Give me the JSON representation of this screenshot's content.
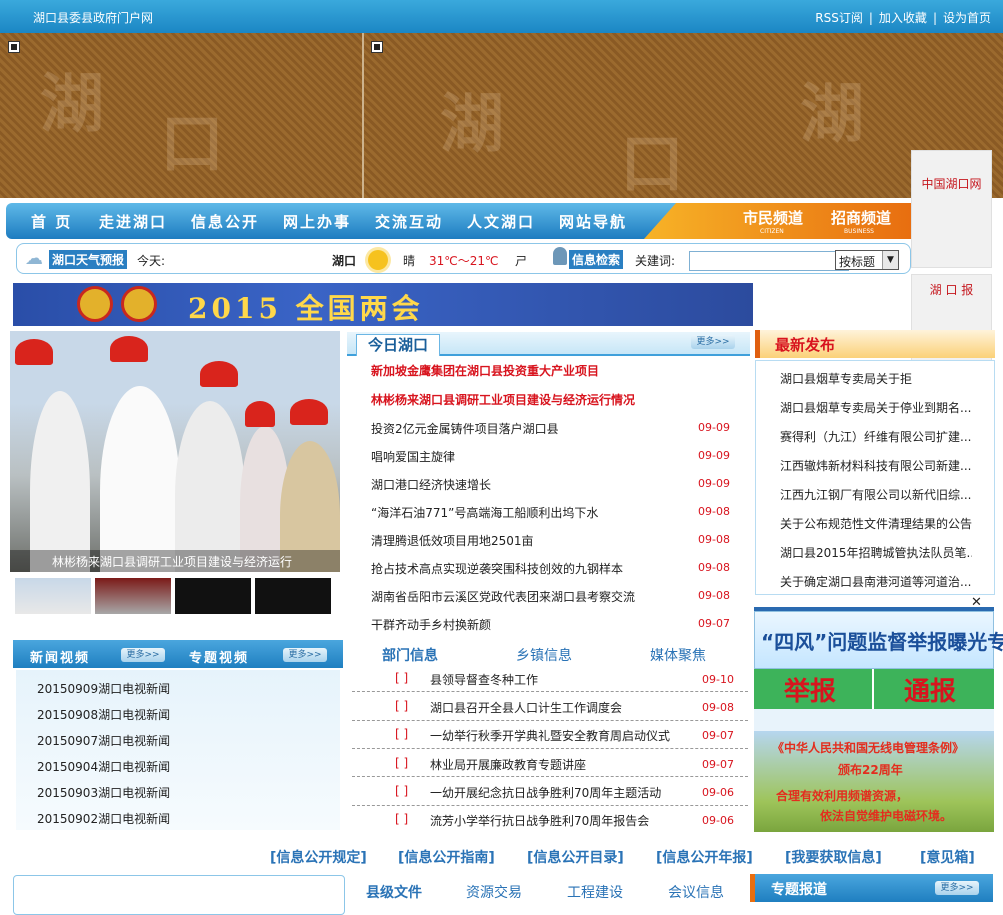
{
  "topbar": {
    "site_name": "湖口县委县政府门户网",
    "rss": "RSS订阅",
    "favorite": "加入收藏",
    "homepage": "设为首页"
  },
  "nav": {
    "items": [
      "首 页",
      "走进湖口",
      "信息公开",
      "网上办事",
      "交流互动",
      "人文湖口",
      "网站导航"
    ],
    "channels": [
      {
        "label": "市民频道",
        "en": "CITIZEN"
      },
      {
        "label": "招商频道",
        "en": "BUSINESS"
      }
    ]
  },
  "weather": {
    "tag": "湖口天气预报",
    "today_label": "今天:",
    "city": "湖口",
    "condition": "晴",
    "temperature": "31℃～21℃",
    "wind": "ㄕ",
    "search_tag": "信息检索",
    "keyword_label": "关建词:",
    "search_type": "按标题"
  },
  "ad_banner": {
    "text": "2015 全国两会"
  },
  "float": {
    "link1": "中国湖口网",
    "link2": "湖 口 报"
  },
  "photo": {
    "caption": "林彬杨来湖口县调研工业项目建设与经济运行"
  },
  "video": {
    "tab1": "新闻视频",
    "tab2": "专题视频",
    "more": "更多>>",
    "items": [
      "20150909湖口电视新闻",
      "20150908湖口电视新闻",
      "20150907湖口电视新闻",
      "20150904湖口电视新闻",
      "20150903湖口电视新闻",
      "20150902湖口电视新闻"
    ]
  },
  "today": {
    "title": "今日湖口",
    "more": "更多>>",
    "headlines": [
      "新加坡金鹰集团在湖口县投资重大产业项目",
      "林彬杨来湖口县调研工业项目建设与经济运行情况"
    ],
    "items": [
      {
        "title": "投资2亿元金属铸件项目落户湖口县",
        "date": "09-09"
      },
      {
        "title": "唱响爱国主旋律",
        "date": "09-09"
      },
      {
        "title": "湖口港口经济快速增长",
        "date": "09-09"
      },
      {
        "title": "“海洋石油771”号高端海工船顺利出坞下水",
        "date": "09-08"
      },
      {
        "title": "清理腾退低效项目用地2501亩",
        "date": "09-08"
      },
      {
        "title": "抢占技术高点实现逆袭突围科技创效的九钢样本",
        "date": "09-08"
      },
      {
        "title": "湖南省岳阳市云溪区党政代表团来湖口县考察交流",
        "date": "09-08"
      },
      {
        "title": "干群齐动手乡村换新颜",
        "date": "09-07"
      }
    ]
  },
  "dept": {
    "tabs": [
      "部门信息",
      "乡镇信息",
      "媒体聚焦"
    ],
    "items": [
      {
        "title": "县领导督查冬种工作",
        "date": "09-10"
      },
      {
        "title": "湖口县召开全县人口计生工作调度会",
        "date": "09-08"
      },
      {
        "title": "一幼举行秋季开学典礼暨安全教育周启动仪式",
        "date": "09-07"
      },
      {
        "title": "林业局开展廉政教育专题讲座",
        "date": "09-07"
      },
      {
        "title": "一幼开展纪念抗日战争胜利70周年主题活动",
        "date": "09-06"
      },
      {
        "title": "流芳小学举行抗日战争胜利70周年报告会",
        "date": "09-06"
      }
    ]
  },
  "latest": {
    "title": "最新发布",
    "items": [
      "湖口县烟草专卖局关于拒",
      "湖口县烟草专卖局关于停业到期名...",
      "赛得利（九江）纤维有限公司扩建...",
      "江西辙炜新材料科技有限公司新建...",
      "江西九江钢厂有限公司以新代旧综...",
      "关于公布规范性文件清理结果的公告",
      "湖口县2015年招聘城管执法队员笔...",
      "关于确定湖口县南港河道等河道治..."
    ]
  },
  "popup": {
    "title": "“四风”问题监督举报曝光专区",
    "btn1": "举报",
    "btn2": "通报",
    "banner_line1": "《中华人民共和国无线电管理条例》",
    "banner_line2": "颁布22周年",
    "banner_line3": "合理有效利用频谱资源，",
    "banner_line4": "依法自觉维护电磁环境。"
  },
  "info_links": [
    "[信息公开规定]",
    "[信息公开指南]",
    "[信息公开目录]",
    "[信息公开年报]",
    "[我要获取信息]",
    "[意见箱]"
  ],
  "bottom_tabs": [
    "县级文件",
    "资源交易",
    "工程建设",
    "会议信息"
  ],
  "special": {
    "title": "专题报道",
    "more": "更多>>"
  },
  "colors": {
    "accent": "#1d7cc0",
    "red": "#d8141e",
    "orange": "#e86e10"
  }
}
